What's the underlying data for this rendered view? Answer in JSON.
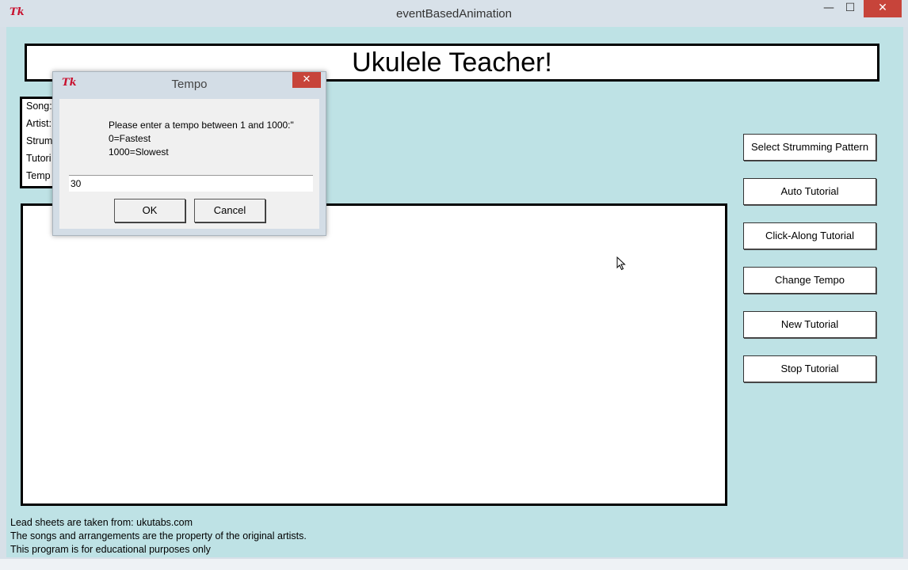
{
  "window": {
    "title": "eventBasedAnimation",
    "app_icon": "Tk",
    "controls": {
      "minimize": "—",
      "maximize": "☐",
      "close": "✕"
    }
  },
  "header": {
    "title": "Ukulele Teacher!"
  },
  "info": {
    "lines": [
      "Song:",
      "Artist:",
      "Strum",
      "Tutori",
      "Temp"
    ]
  },
  "sidebar": {
    "buttons": [
      {
        "label": "Select Strumming Pattern"
      },
      {
        "label": "Auto Tutorial"
      },
      {
        "label": "Click-Along Tutorial"
      },
      {
        "label": "Change Tempo"
      },
      {
        "label": "New Tutorial"
      },
      {
        "label": "Stop Tutorial"
      }
    ]
  },
  "footer": {
    "lines": [
      "Lead sheets are taken from: ukutabs.com",
      "The songs and arrangements are the property of the original artists.",
      "This program is for educational purposes only"
    ]
  },
  "dialog": {
    "title": "Tempo",
    "app_icon": "Tk",
    "close": "✕",
    "prompt": [
      "Please enter a tempo between 1 and 1000:\"",
      "0=Fastest",
      "1000=Slowest"
    ],
    "input_value": "30",
    "ok_label": "OK",
    "cancel_label": "Cancel"
  },
  "colors": {
    "canvas": "#bee2e5",
    "close_button": "#c7443a",
    "tk_red": "#c8102e"
  }
}
